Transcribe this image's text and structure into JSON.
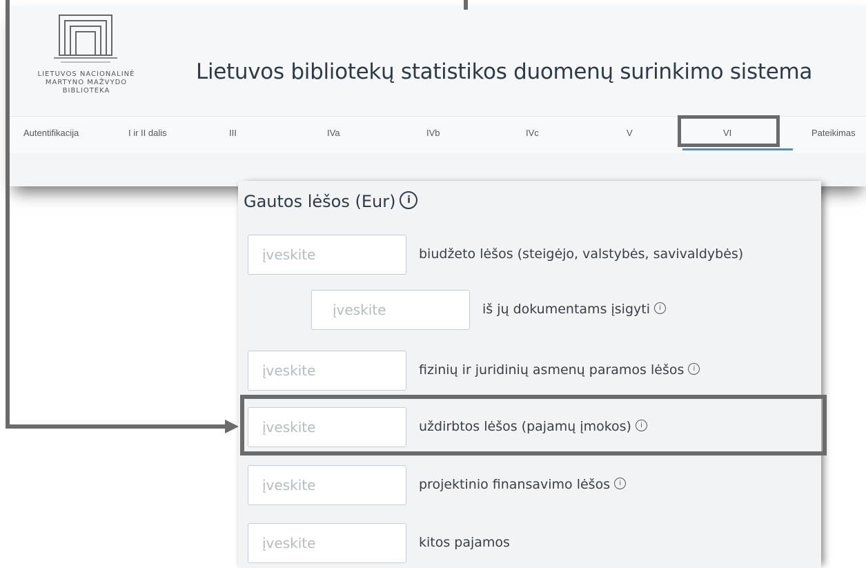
{
  "header": {
    "logo_lines": [
      "LIETUVOS NACIONALINĖ",
      "MARTYNO MAŽVYDO",
      "BIBLIOTEKA"
    ],
    "title": "Lietuvos bibliotekų statistikos duomenų surinkimo sistema"
  },
  "nav": {
    "items": [
      {
        "label": "Autentifikacija"
      },
      {
        "label": "I ir II dalis"
      },
      {
        "label": "III"
      },
      {
        "label": "IVa"
      },
      {
        "label": "IVb"
      },
      {
        "label": "IVc"
      },
      {
        "label": "V"
      },
      {
        "label": "VI",
        "active": true
      },
      {
        "label": "Pateikimas"
      }
    ]
  },
  "form": {
    "title": "Gautos lėšos (Eur)",
    "title_icon": "info-circle-icon",
    "rows": [
      {
        "placeholder": "įveskite",
        "label": "biudžeto lėšos (steigėjo, valstybės, savivaldybės)",
        "info": false
      },
      {
        "placeholder": "įveskite",
        "label": "iš jų dokumentams įsigyti",
        "info": true
      },
      {
        "placeholder": "įveskite",
        "label": "fizinių ir juridinių asmenų paramos lėšos",
        "info": true
      },
      {
        "placeholder": "įveskite",
        "label": "uždirbtos lėšos (pajamų įmokos)",
        "info": true,
        "highlighted": true
      },
      {
        "placeholder": "įveskite",
        "label": "projektinio finansavimo lėšos",
        "info": true
      },
      {
        "placeholder": "įveskite",
        "label": "kitos pajamos",
        "info": false
      }
    ]
  },
  "colors": {
    "annotation": "#6b6b6b",
    "active_underline": "#4a90c8",
    "title_text": "#2f3a45"
  }
}
